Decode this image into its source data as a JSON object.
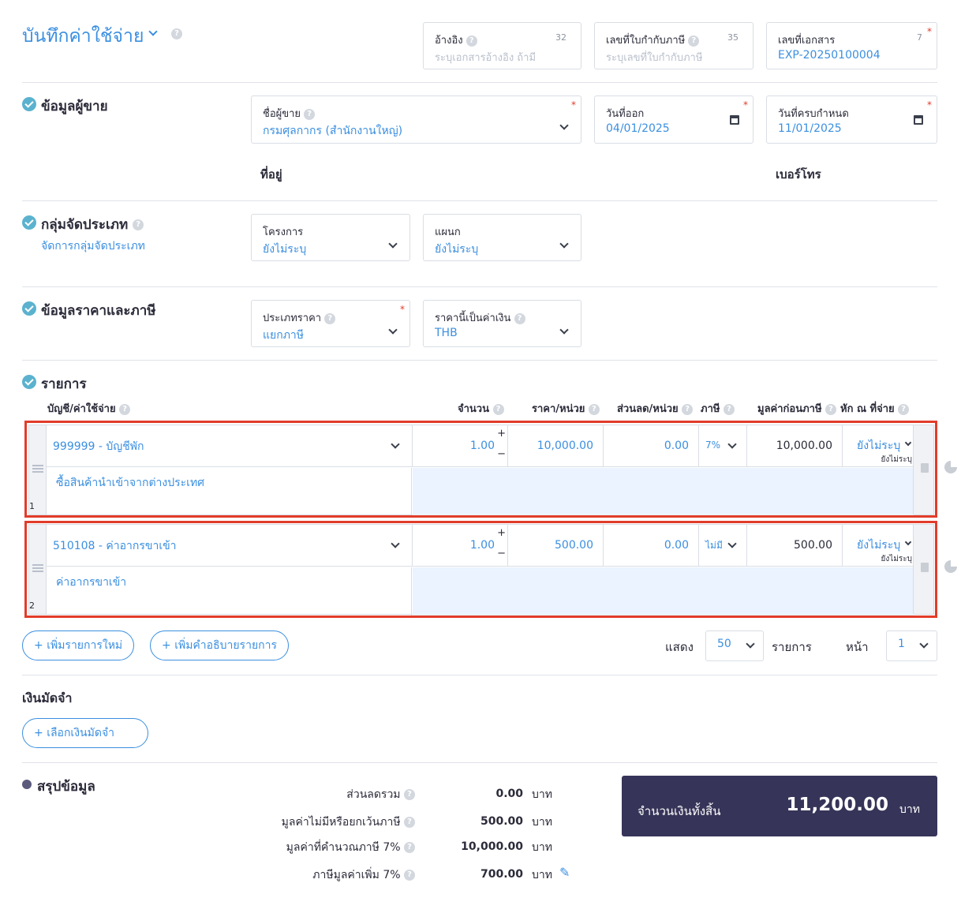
{
  "header": {
    "title": "บันทึกค่าใช้จ่าย",
    "reference": {
      "label": "อ้างอิง",
      "count": "32",
      "placeholder": "ระบุเอกสารอ้างอิง ถ้ามี"
    },
    "tax_invoice_no": {
      "label": "เลขที่ใบกำกับภาษี",
      "count": "35",
      "placeholder": "ระบุเลขที่ใบกำกับภาษี"
    },
    "document_no": {
      "label": "เลขที่เอกสาร",
      "count": "7",
      "value": "EXP-20250100004"
    }
  },
  "vendor_section": {
    "title": "ข้อมูลผู้ขาย",
    "vendor": {
      "label": "ชื่อผู้ขาย",
      "value": "กรมศุลกากร (สำนักงานใหญ่)"
    },
    "issue_date": {
      "label": "วันที่ออก",
      "value": "04/01/2025"
    },
    "due_date": {
      "label": "วันที่ครบกำหนด",
      "value": "11/01/2025"
    },
    "address_label": "ที่อยู่",
    "phone_label": "เบอร์โทร"
  },
  "category_section": {
    "title": "กลุ่มจัดประเภท",
    "manage_link": "จัดการกลุ่มจัดประเภท",
    "project": {
      "label": "โครงการ",
      "value": "ยังไม่ระบุ"
    },
    "department": {
      "label": "แผนก",
      "value": "ยังไม่ระบุ"
    }
  },
  "price_section": {
    "title": "ข้อมูลราคาและภาษี",
    "price_type": {
      "label": "ประเภทราคา",
      "value": "แยกภาษี"
    },
    "currency": {
      "label": "ราคานี้เป็นค่าเงิน",
      "value": "THB"
    }
  },
  "items_section": {
    "title": "รายการ",
    "columns": {
      "account": "บัญชี/ค่าใช้จ่าย",
      "qty": "จำนวน",
      "unit_price": "ราคา/หน่วย",
      "discount": "ส่วนลด/หน่วย",
      "tax": "ภาษี",
      "pretax": "มูลค่าก่อนภาษี",
      "withholding": "หัก ณ ที่จ่าย"
    },
    "rows": [
      {
        "index": "1",
        "account": "999999 - บัญชีพัก",
        "qty": "1.00",
        "unit_price": "10,000.00",
        "discount": "0.00",
        "tax": "7%",
        "pretax": "10,000.00",
        "withholding": "ยังไม่ระบุ",
        "withholding_sub": "ยังไม่ระบุ",
        "description": "ซื้อสินค้านำเข้าจากต่างประเทศ"
      },
      {
        "index": "2",
        "account": "510108 - ค่าอากรขาเข้า",
        "qty": "1.00",
        "unit_price": "500.00",
        "discount": "0.00",
        "tax": "ไม่มี",
        "pretax": "500.00",
        "withholding": "ยังไม่ระบุ",
        "withholding_sub": "ยังไม่ระบุ",
        "description": "ค่าอากรขาเข้า"
      }
    ],
    "add_item_button": "เพิ่มรายการใหม่",
    "add_desc_button": "เพิ่มคำอธิบายรายการ",
    "show_label": "แสดง",
    "show_value": "50",
    "items_label": "รายการ",
    "page_label": "หน้า",
    "page_value": "1"
  },
  "deposit_section": {
    "title": "เงินมัดจำ",
    "select_button": "เลือกเงินมัดจำ"
  },
  "summary": {
    "title": "สรุปข้อมูล",
    "lines": [
      {
        "label": "ส่วนลดรวม",
        "value": "0.00",
        "unit": "บาท"
      },
      {
        "label": "มูลค่าไม่มีหรือยกเว้นภาษี",
        "value": "500.00",
        "unit": "บาท"
      },
      {
        "label": "มูลค่าที่คำนวณภาษี 7%",
        "value": "10,000.00",
        "unit": "บาท"
      },
      {
        "label": "ภาษีมูลค่าเพิ่ม 7%",
        "value": "700.00",
        "unit": "บาท"
      }
    ],
    "total_label": "จำนวนเงินทั้งสิ้น",
    "total_value": "11,200.00",
    "total_unit": "บาท"
  },
  "colors": {
    "accent": "#3b8fe0",
    "highlight": "#e23c2a",
    "total_bg": "#363458",
    "check": "#5bb2cf"
  }
}
